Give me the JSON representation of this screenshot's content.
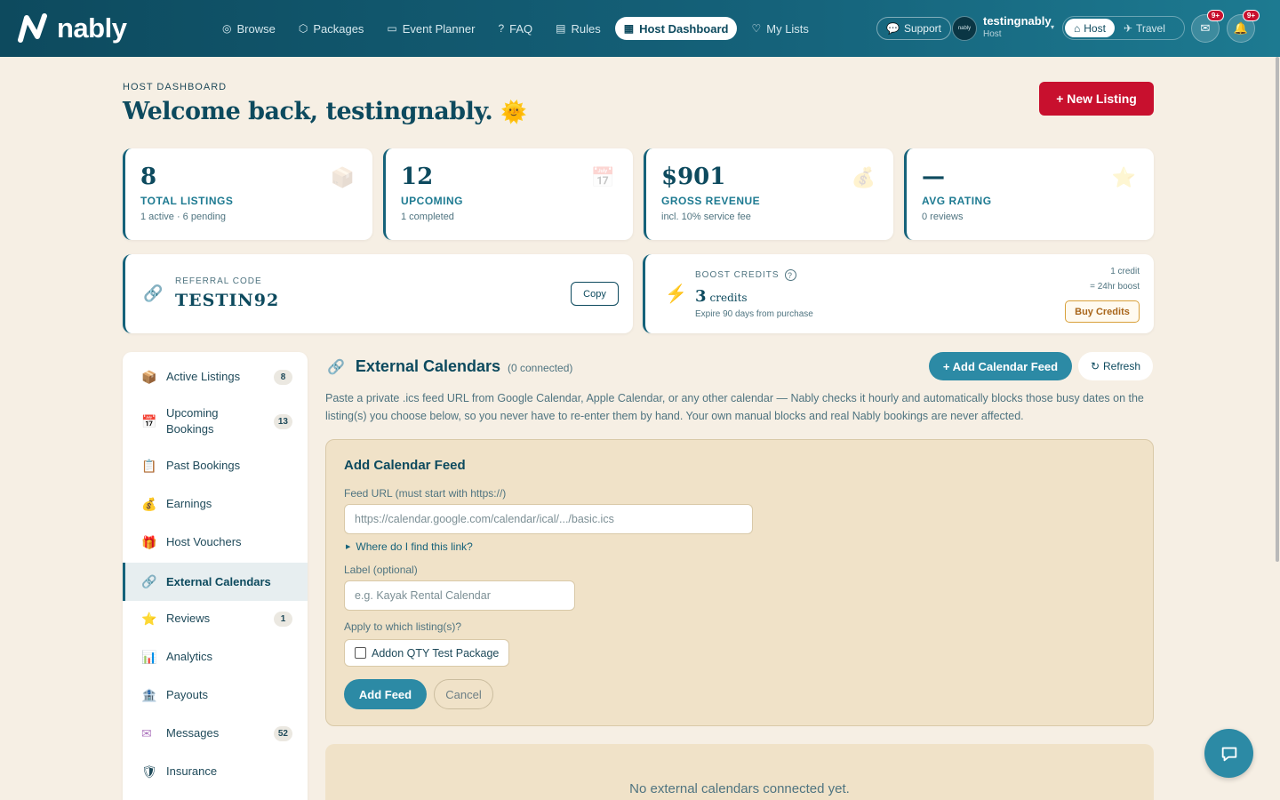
{
  "nav": {
    "logo_text": "nably",
    "links": [
      {
        "label": "Browse",
        "icon": "compass-icon",
        "glyph": "◎"
      },
      {
        "label": "Packages",
        "icon": "box-icon",
        "glyph": "⬡"
      },
      {
        "label": "Event Planner",
        "icon": "map-icon",
        "glyph": "▭"
      },
      {
        "label": "FAQ",
        "icon": "help-icon",
        "glyph": "?"
      },
      {
        "label": "Rules",
        "icon": "clipboard-icon",
        "glyph": "▤"
      },
      {
        "label": "Host Dashboard",
        "icon": "grid-icon",
        "glyph": "▦"
      },
      {
        "label": "My Lists",
        "icon": "heart-icon",
        "glyph": "♡"
      }
    ],
    "active_link": "Host Dashboard",
    "support_label": "Support",
    "avatar_text": "nably",
    "user_name": "testingnably",
    "user_role": "Host",
    "mode_host": "Host",
    "mode_travel": "Travel",
    "mail_badge": "9+",
    "bell_badge": "9+"
  },
  "header": {
    "eyebrow": "HOST DASHBOARD",
    "welcome": "Welcome back, testingnably.",
    "emoji": "🌞",
    "new_listing": "+ New Listing"
  },
  "stats": [
    {
      "value": "8",
      "label": "TOTAL LISTINGS",
      "sub": "1 active · 6 pending",
      "icon": "box-icon",
      "glyph": "📦"
    },
    {
      "value": "12",
      "label": "UPCOMING",
      "sub": "1 completed",
      "icon": "calendar-icon",
      "glyph": "📅"
    },
    {
      "value": "$901",
      "label": "GROSS REVENUE",
      "sub": "incl. 10% service fee",
      "icon": "money-bag-icon",
      "glyph": "💰"
    },
    {
      "value": "—",
      "label": "AVG RATING",
      "sub": "0 reviews",
      "icon": "star-icon",
      "glyph": "⭐"
    }
  ],
  "referral": {
    "label": "REFERRAL CODE",
    "code": "TESTIN92",
    "copy": "Copy"
  },
  "boost": {
    "label": "BOOST CREDITS",
    "count": "3",
    "unit": "credits",
    "expire": "Expire 90 days from purchase",
    "rate_line1": "1 credit",
    "rate_line2": "= 24hr boost",
    "buy": "Buy Credits"
  },
  "sidebar": {
    "items": [
      {
        "label": "Active Listings",
        "count": "8",
        "icon": "box-icon",
        "glyph": "📦"
      },
      {
        "label": "Upcoming Bookings",
        "count": "13",
        "icon": "calendar-icon",
        "glyph": "📅"
      },
      {
        "label": "Past Bookings",
        "count": "",
        "icon": "clipboard-icon",
        "glyph": "📋"
      },
      {
        "label": "Earnings",
        "count": "",
        "icon": "money-bag-icon",
        "glyph": "💰"
      },
      {
        "label": "Host Vouchers",
        "count": "",
        "icon": "gift-icon",
        "glyph": "🎁"
      },
      {
        "label": "External Calendars",
        "count": "",
        "icon": "link-icon",
        "glyph": "🔗"
      },
      {
        "label": "Reviews",
        "count": "1",
        "icon": "star-icon",
        "glyph": "⭐"
      },
      {
        "label": "Analytics",
        "count": "",
        "icon": "chart-icon",
        "glyph": "📊"
      },
      {
        "label": "Payouts",
        "count": "",
        "icon": "bank-icon",
        "glyph": "🏦"
      },
      {
        "label": "Messages",
        "count": "52",
        "icon": "envelope-icon",
        "glyph": "✉"
      },
      {
        "label": "Insurance",
        "count": "",
        "icon": "shield-icon",
        "glyph": "🛡"
      }
    ],
    "active": "External Calendars"
  },
  "main": {
    "title": "External Calendars",
    "connected": "(0 connected)",
    "add_calendar_feed": "+ Add Calendar Feed",
    "refresh": "Refresh",
    "description": "Paste a private .ics feed URL from Google Calendar, Apple Calendar, or any other calendar — Nably checks it hourly and automatically blocks those busy dates on the listing(s) you choose below, so you never have to re-enter them by hand. Your own manual blocks and real Nably bookings are never affected.",
    "form": {
      "title": "Add Calendar Feed",
      "url_label": "Feed URL (must start with https://)",
      "url_placeholder": "https://calendar.google.com/calendar/ical/.../basic.ics",
      "url_value": "",
      "hint": "Where do I find this link?",
      "label_label": "Label (optional)",
      "label_placeholder": "e.g. Kayak Rental Calendar",
      "label_value": "",
      "apply_label": "Apply to which listing(s)?",
      "listing_option": "Addon QTY Test Package",
      "listing_checked": false,
      "submit": "Add Feed",
      "cancel": "Cancel"
    },
    "empty_text": "No external calendars connected yet."
  },
  "colors": {
    "nav_bg": "#0d4a5e",
    "accent": "#2c8aa5",
    "brand_red": "#c8102e",
    "page_bg": "#f6efe4",
    "form_bg": "#f0e2c8"
  }
}
